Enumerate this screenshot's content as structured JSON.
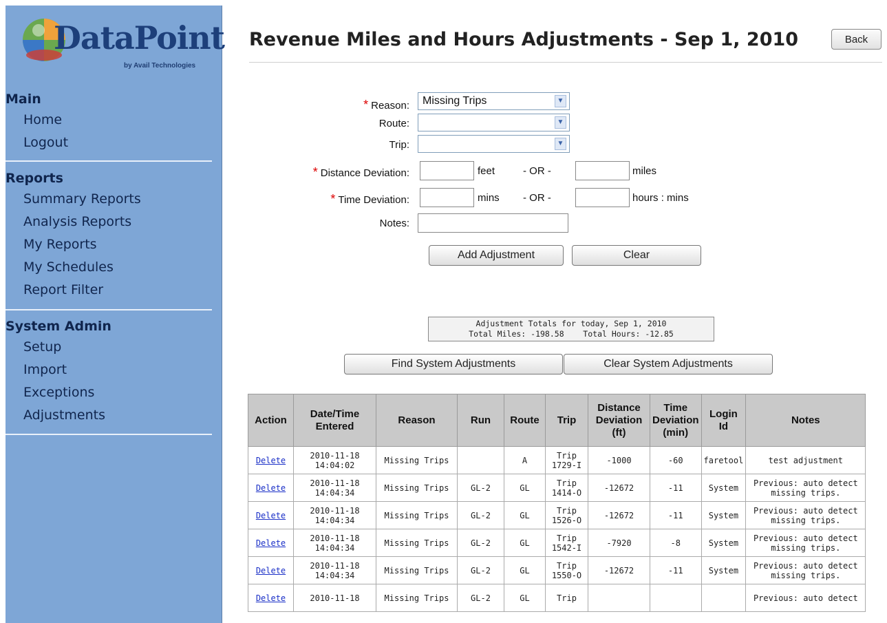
{
  "logo": {
    "word": "DataPoint",
    "byline": "by Avail Technologies"
  },
  "sidebar": {
    "sections": [
      {
        "title": "Main",
        "items": [
          "Home",
          "Logout"
        ]
      },
      {
        "title": "Reports",
        "items": [
          "Summary Reports",
          "Analysis Reports",
          "My Reports",
          "My Schedules",
          "Report Filter"
        ]
      },
      {
        "title": "System Admin",
        "items": [
          "Setup",
          "Import",
          "Exceptions",
          "Adjustments"
        ]
      }
    ]
  },
  "header": {
    "title": "Revenue Miles and Hours Adjustments - Sep 1, 2010",
    "back_label": "Back"
  },
  "form": {
    "required_mark": "*",
    "reason_label": "Reason:",
    "reason_value": "Missing Trips",
    "route_label": "Route:",
    "route_value": "",
    "trip_label": "Trip:",
    "trip_value": "",
    "distance_label": "Distance Deviation:",
    "distance_unit1": "feet",
    "or_text": "- OR -",
    "distance_unit2": "miles",
    "time_label": "Time Deviation:",
    "time_unit1": "mins",
    "time_unit2": "hours : mins",
    "notes_label": "Notes:",
    "add_button": "Add Adjustment",
    "clear_button": "Clear"
  },
  "totals": {
    "line1": "Adjustment Totals for today, Sep 1, 2010",
    "line2": "Total Miles: -198.58    Total Hours: -12.85"
  },
  "actions": {
    "find_button": "Find System Adjustments",
    "clear_system_button": "Clear System Adjustments"
  },
  "table": {
    "headers": [
      "Action",
      "Date/Time Entered",
      "Reason",
      "Run",
      "Route",
      "Trip",
      "Distance Deviation (ft)",
      "Time Deviation (min)",
      "Login Id",
      "Notes"
    ],
    "rows": [
      [
        "Delete",
        "2010-11-18 14:04:02",
        "Missing Trips",
        "",
        "A",
        "Trip 1729-I",
        "-1000",
        "-60",
        "faretool",
        "test adjustment"
      ],
      [
        "Delete",
        "2010-11-18 14:04:34",
        "Missing Trips",
        "GL-2",
        "GL",
        "Trip 1414-O",
        "-12672",
        "-11",
        "System",
        "Previous: auto detect missing trips."
      ],
      [
        "Delete",
        "2010-11-18 14:04:34",
        "Missing Trips",
        "GL-2",
        "GL",
        "Trip 1526-O",
        "-12672",
        "-11",
        "System",
        "Previous: auto detect missing trips."
      ],
      [
        "Delete",
        "2010-11-18 14:04:34",
        "Missing Trips",
        "GL-2",
        "GL",
        "Trip 1542-I",
        "-7920",
        "-8",
        "System",
        "Previous: auto detect missing trips."
      ],
      [
        "Delete",
        "2010-11-18 14:04:34",
        "Missing Trips",
        "GL-2",
        "GL",
        "Trip 1550-O",
        "-12672",
        "-11",
        "System",
        "Previous: auto detect missing trips."
      ],
      [
        "Delete",
        "2010-11-18",
        "Missing Trips",
        "GL-2",
        "GL",
        "Trip",
        "",
        "",
        "",
        "Previous: auto detect"
      ]
    ]
  }
}
